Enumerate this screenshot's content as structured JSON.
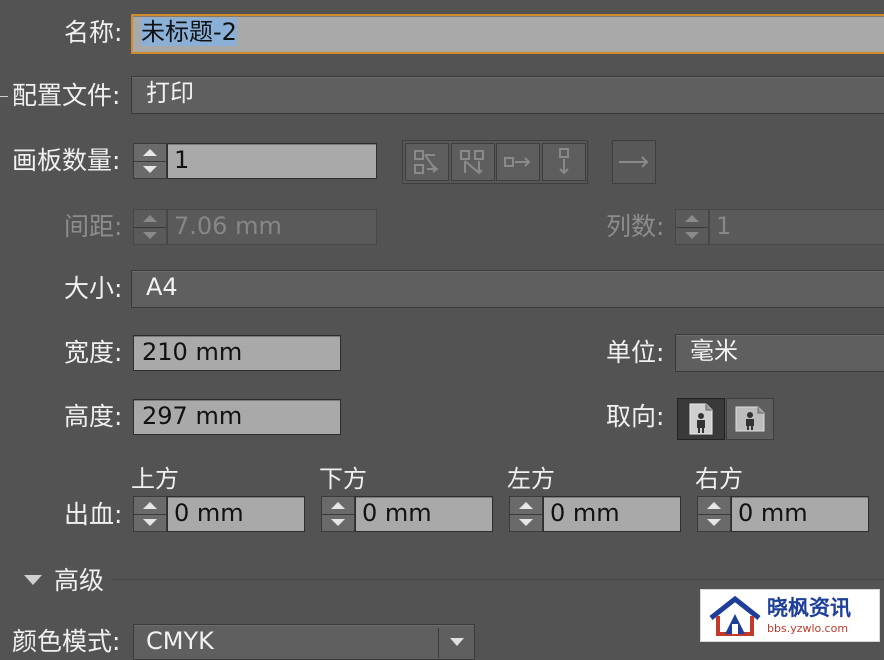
{
  "name": {
    "label": "名称:",
    "value": "未标题-2"
  },
  "profile": {
    "label": "配置文件:",
    "value": "打印"
  },
  "artboards": {
    "label": "画板数量:",
    "value": "1"
  },
  "spacing": {
    "label": "间距:",
    "value": "7.06 mm"
  },
  "columns": {
    "label": "列数:",
    "value": "1"
  },
  "size": {
    "label": "大小:",
    "value": "A4"
  },
  "width": {
    "label": "宽度:",
    "value": "210 mm"
  },
  "units": {
    "label": "单位:",
    "value": "毫米"
  },
  "height": {
    "label": "高度:",
    "value": "297 mm"
  },
  "orientation": {
    "label": "取向:",
    "selected": "portrait"
  },
  "bleed": {
    "label": "出血:",
    "top": {
      "label": "上方",
      "value": "0 mm"
    },
    "bottom": {
      "label": "下方",
      "value": "0 mm"
    },
    "left": {
      "label": "左方",
      "value": "0 mm"
    },
    "right": {
      "label": "右方",
      "value": "0 mm"
    }
  },
  "advanced": {
    "label": "高级"
  },
  "color_mode": {
    "label": "颜色模式:",
    "value": "CMYK"
  },
  "watermark": {
    "title": "晓枫资讯",
    "url": "bbs.yzwlo.com"
  },
  "colors": {
    "panel": "#535353",
    "field": "#a9a9a9",
    "focus": "#d38a2f",
    "selection": "#8ab0d8"
  }
}
